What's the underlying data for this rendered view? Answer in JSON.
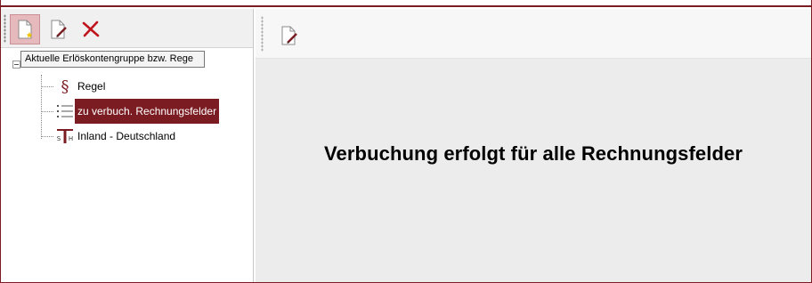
{
  "toolbar": {
    "buttons": [
      {
        "icon": "new-document-icon",
        "active": true
      },
      {
        "icon": "edit-document-icon",
        "active": false
      },
      {
        "icon": "delete-icon",
        "active": false
      }
    ],
    "tooltip": "Aktuelle Erlöskontengruppe bzw. Rege"
  },
  "tree": {
    "items": [
      {
        "icon": "paragraph-icon",
        "label": "Regel",
        "selected": false
      },
      {
        "icon": "list-icon",
        "label": "zu verbuch. Rechnungsfelder",
        "selected": true
      },
      {
        "icon": "tax-key-icon",
        "label": "Inland - Deutschland",
        "selected": false
      }
    ]
  },
  "right": {
    "toolbar_icon": "edit-document-icon",
    "message": "Verbuchung erfolgt für alle Rechnungsfelder"
  },
  "colors": {
    "accent": "#7a1c22",
    "active_button_bg": "#e6b9bc",
    "delete_red": "#c0141e"
  }
}
